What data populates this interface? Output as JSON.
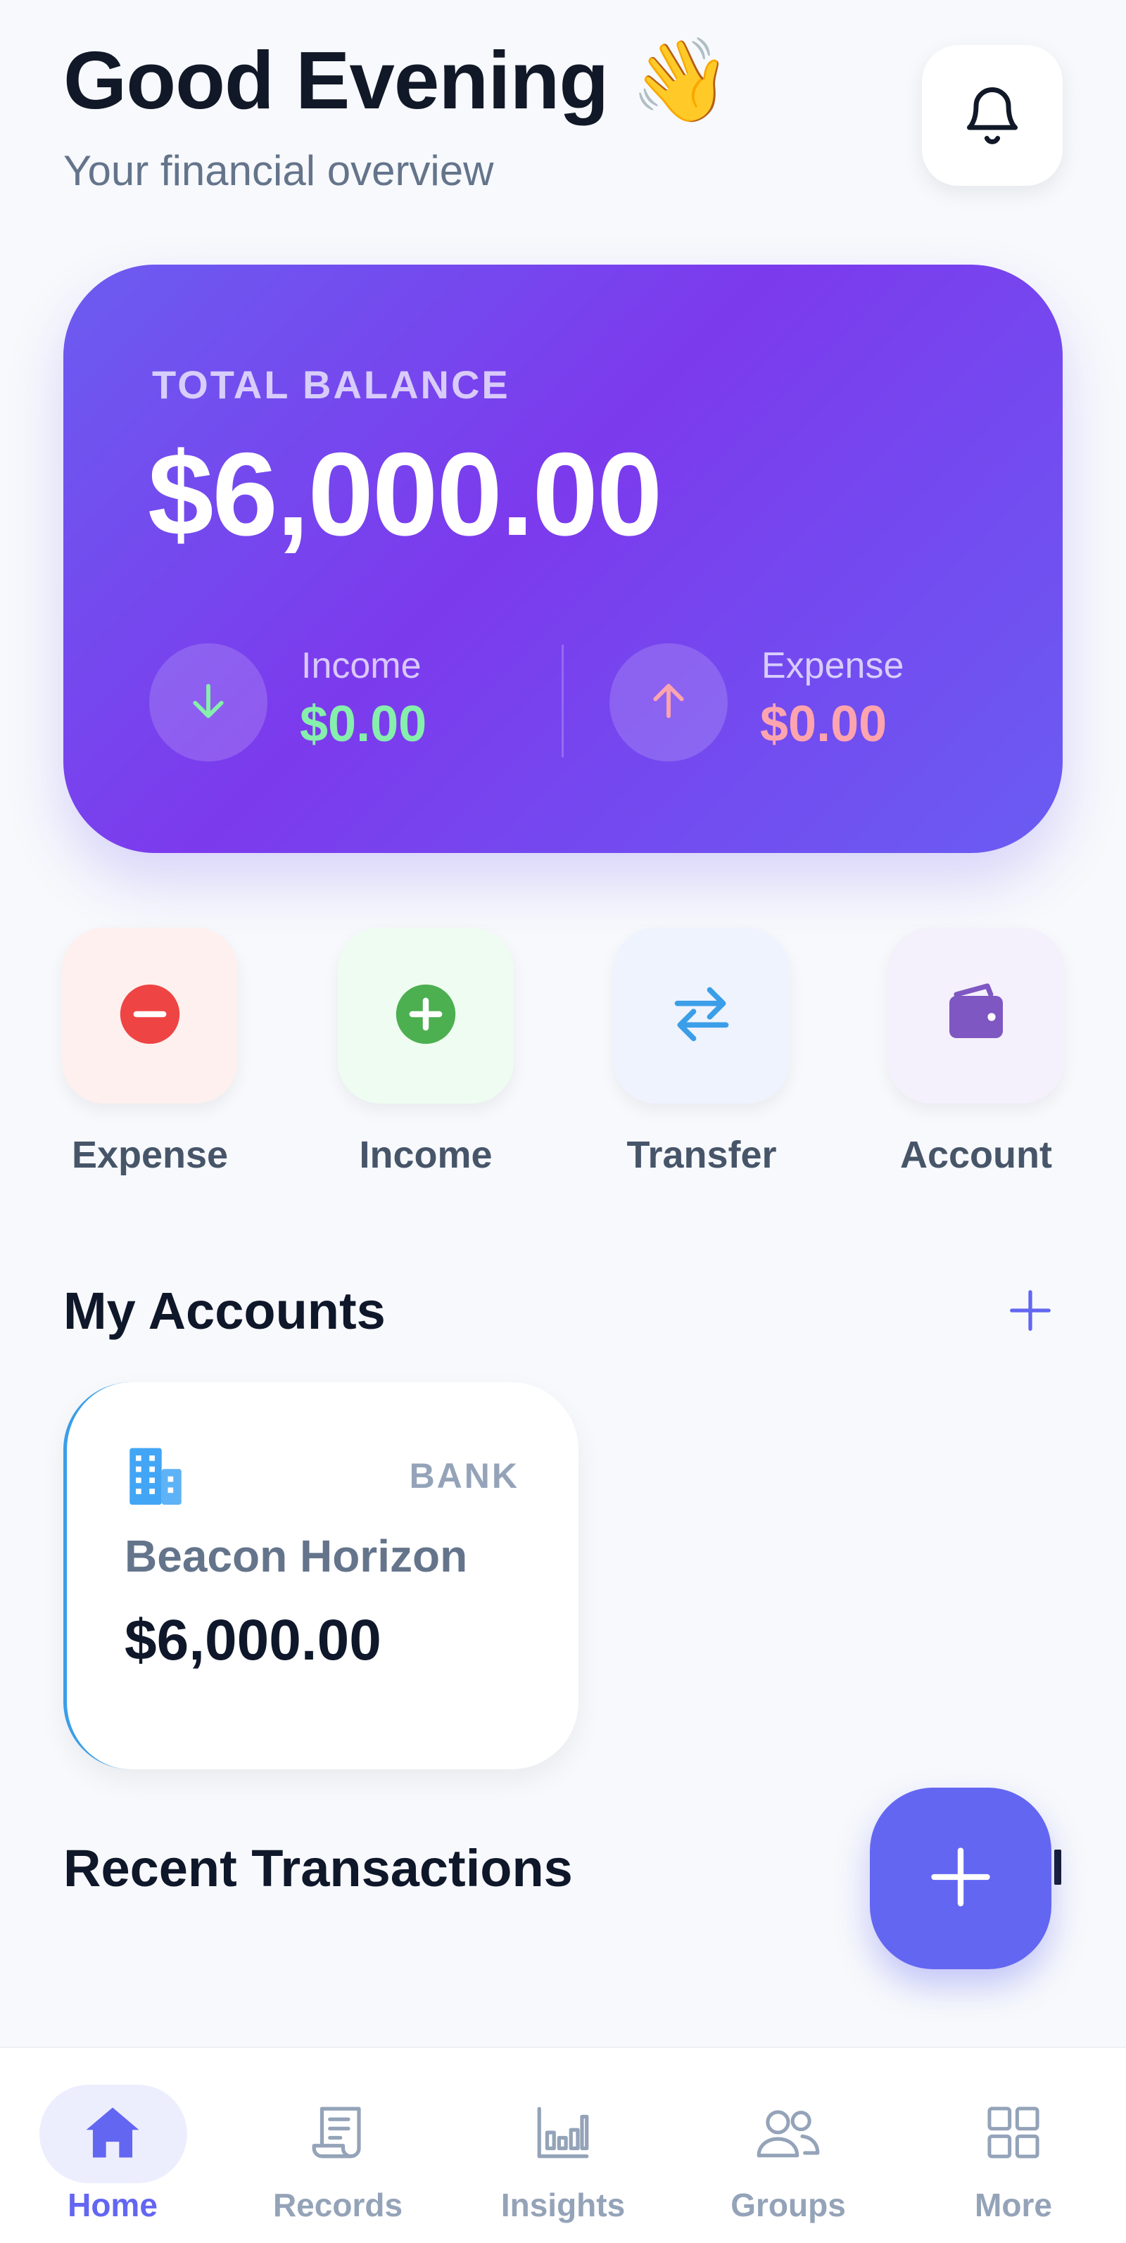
{
  "header": {
    "greeting": "Good Evening 👋",
    "subtitle": "Your financial overview"
  },
  "balance": {
    "label": "TOTAL BALANCE",
    "amount": "$6,000.00",
    "income_label": "Income",
    "income_value": "$0.00",
    "expense_label": "Expense",
    "expense_value": "$0.00"
  },
  "quick_actions": [
    {
      "label": "Expense",
      "icon": "minus-circle-icon",
      "tile_color": "#fdf0ee",
      "icon_color": "#ef4444"
    },
    {
      "label": "Income",
      "icon": "plus-circle-icon",
      "tile_color": "#effcf1",
      "icon_color": "#4caf50"
    },
    {
      "label": "Transfer",
      "icon": "transfer-arrows-icon",
      "tile_color": "#eff3fd",
      "icon_color": "#3b9ee8"
    },
    {
      "label": "Account",
      "icon": "wallet-icon",
      "tile_color": "#f4f0fc",
      "icon_color": "#7e57c2"
    }
  ],
  "accounts": {
    "title": "My Accounts",
    "items": [
      {
        "type": "BANK",
        "name": "Beacon Horizon",
        "balance": "$6,000.00",
        "icon": "building-icon",
        "accent": "#3b9ee8"
      }
    ]
  },
  "recent": {
    "title": "Recent Transactions"
  },
  "nav": {
    "items": [
      {
        "label": "Home",
        "icon": "home-icon",
        "active": true
      },
      {
        "label": "Records",
        "icon": "receipt-icon",
        "active": false
      },
      {
        "label": "Insights",
        "icon": "bar-chart-icon",
        "active": false
      },
      {
        "label": "Groups",
        "icon": "users-icon",
        "active": false
      },
      {
        "label": "More",
        "icon": "grid-icon",
        "active": false
      }
    ]
  },
  "colors": {
    "primary": "#6366f1",
    "income_green": "#86efac",
    "expense_pink": "#fda4af"
  }
}
